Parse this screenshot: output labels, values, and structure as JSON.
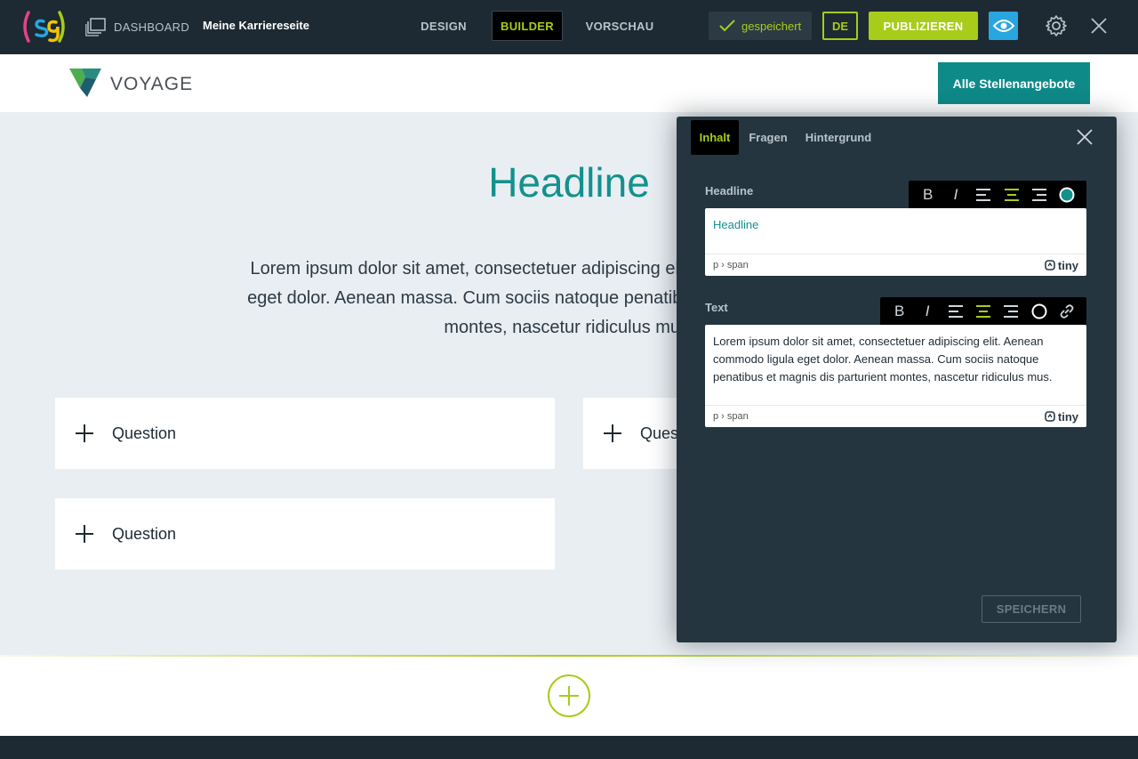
{
  "topbar": {
    "dashboard_label": "DASHBOARD",
    "site_name": "Meine Karriereseite",
    "tabs": [
      {
        "label": "DESIGN",
        "active": false
      },
      {
        "label": "BUILDER",
        "active": true
      },
      {
        "label": "VORSCHAU",
        "active": false
      }
    ],
    "saved_label": "gespeichert",
    "language": "DE",
    "publish_label": "PUBLIZIEREN"
  },
  "site": {
    "brand": "VOYAGE",
    "jobs_button": "Alle Stellenangebote",
    "headline": "Headline",
    "lorem_lines": [
      "Lorem ipsum dolor sit amet, consectetuer adipiscing elit. Aenean commodo ligula",
      "eget dolor. Aenean massa. Cum sociis natoque penatibus et magnis dis parturient",
      "montes, nascetur ridiculus mus."
    ],
    "questions": [
      "Question",
      "Question",
      "Question"
    ]
  },
  "panel": {
    "tabs": [
      {
        "label": "Inhalt",
        "active": true
      },
      {
        "label": "Fragen",
        "active": false
      },
      {
        "label": "Hintergrund",
        "active": false
      }
    ],
    "headline_field": {
      "label": "Headline",
      "value": "Headline",
      "path": "p › span"
    },
    "text_field": {
      "label": "Text",
      "value": "Lorem ipsum dolor sit amet, consectetuer adipiscing elit. Aenean commodo ligula eget dolor. Aenean massa. Cum sociis natoque penatibus et magnis dis parturient montes, nascetur ridiculus mus.",
      "path": "p › span"
    },
    "tiny_label": "tiny",
    "toolbar": {
      "bold": "B",
      "italic": "I"
    },
    "save_label": "SPEICHERN"
  },
  "colors": {
    "accent_green": "#a7cc1a",
    "teal": "#12918d",
    "dark": "#1d2a33",
    "panel": "#243540",
    "preview_blue": "#29a6e0"
  }
}
